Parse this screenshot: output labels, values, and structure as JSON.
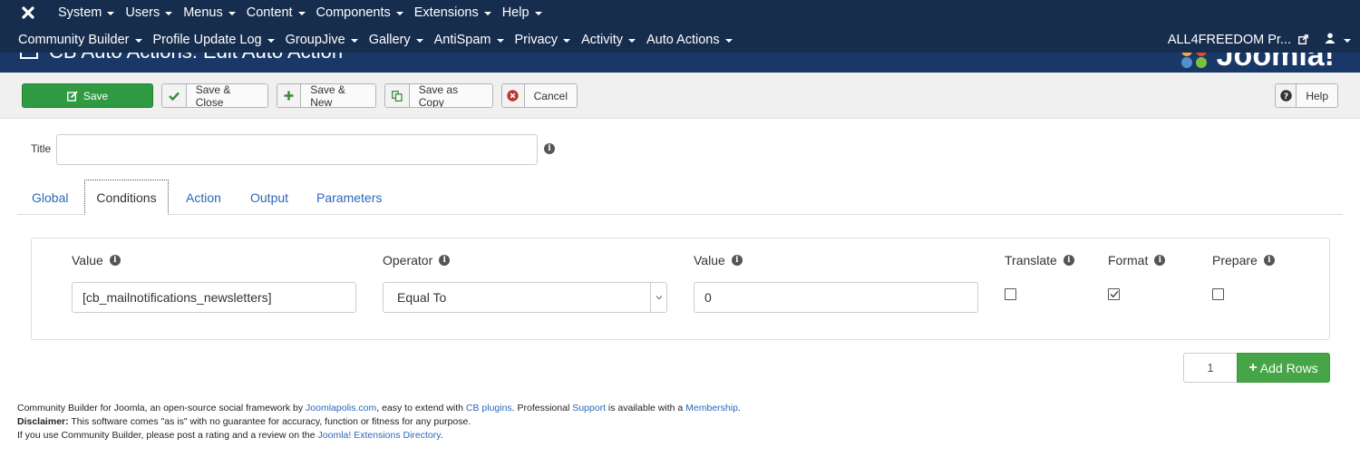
{
  "navbar": {
    "row1": [
      "System",
      "Users",
      "Menus",
      "Content",
      "Components",
      "Extensions",
      "Help"
    ],
    "row2": [
      "Community Builder",
      "Profile Update Log",
      "GroupJive",
      "Gallery",
      "AntiSpam",
      "Privacy",
      "Activity",
      "Auto Actions"
    ],
    "site_name": "ALL4FREEDOM Pr...",
    "colors": {
      "navbar_bg": "#172d4e",
      "subhead_bg": "#1a3867"
    }
  },
  "subhead": {
    "title": "CB Auto Actions: Edit Auto Action",
    "brand": "Joomla!"
  },
  "toolbar": {
    "save": "Save",
    "save_close": "Save & Close",
    "save_new": "Save & New",
    "save_copy": "Save as Copy",
    "cancel": "Cancel",
    "help": "Help",
    "colors": {
      "save_bg": "#2f9a41",
      "check": "#3c8c3c",
      "cancel_icon": "#bd362f"
    }
  },
  "form": {
    "title_label": "Title",
    "title_value": "",
    "tabs": [
      "Global",
      "Conditions",
      "Action",
      "Output",
      "Parameters"
    ],
    "active_tab": "Conditions"
  },
  "conditions": {
    "headers": {
      "value1": "Value",
      "operator": "Operator",
      "value2": "Value",
      "translate": "Translate",
      "format": "Format",
      "prepare": "Prepare"
    },
    "row": {
      "value1": "[cb_mailnotifications_newsletters]",
      "operator": "Equal To",
      "value2": "0",
      "translate": false,
      "format": true,
      "prepare": false
    }
  },
  "add_rows": {
    "count": "1",
    "label": "Add Rows",
    "color": "#46a546"
  },
  "footer": {
    "line1_a": "Community Builder for Joomla, an open-source social framework by ",
    "link_joomlapolis": "Joomlapolis.com",
    "line1_b": ", easy to extend with ",
    "link_plugins": "CB plugins",
    "line1_c": ". Professional ",
    "link_support": "Support",
    "line1_d": " is available with a ",
    "link_membership": "Membership",
    "line1_e": ".",
    "disclaimer_label": "Disclaimer:",
    "disclaimer_text": " This software comes \"as is\" with no guarantee for accuracy, function or fitness for any purpose.",
    "line3_a": "If you use Community Builder, please post a rating and a review on the ",
    "link_jed": "Joomla! Extensions Directory",
    "line3_b": "."
  }
}
